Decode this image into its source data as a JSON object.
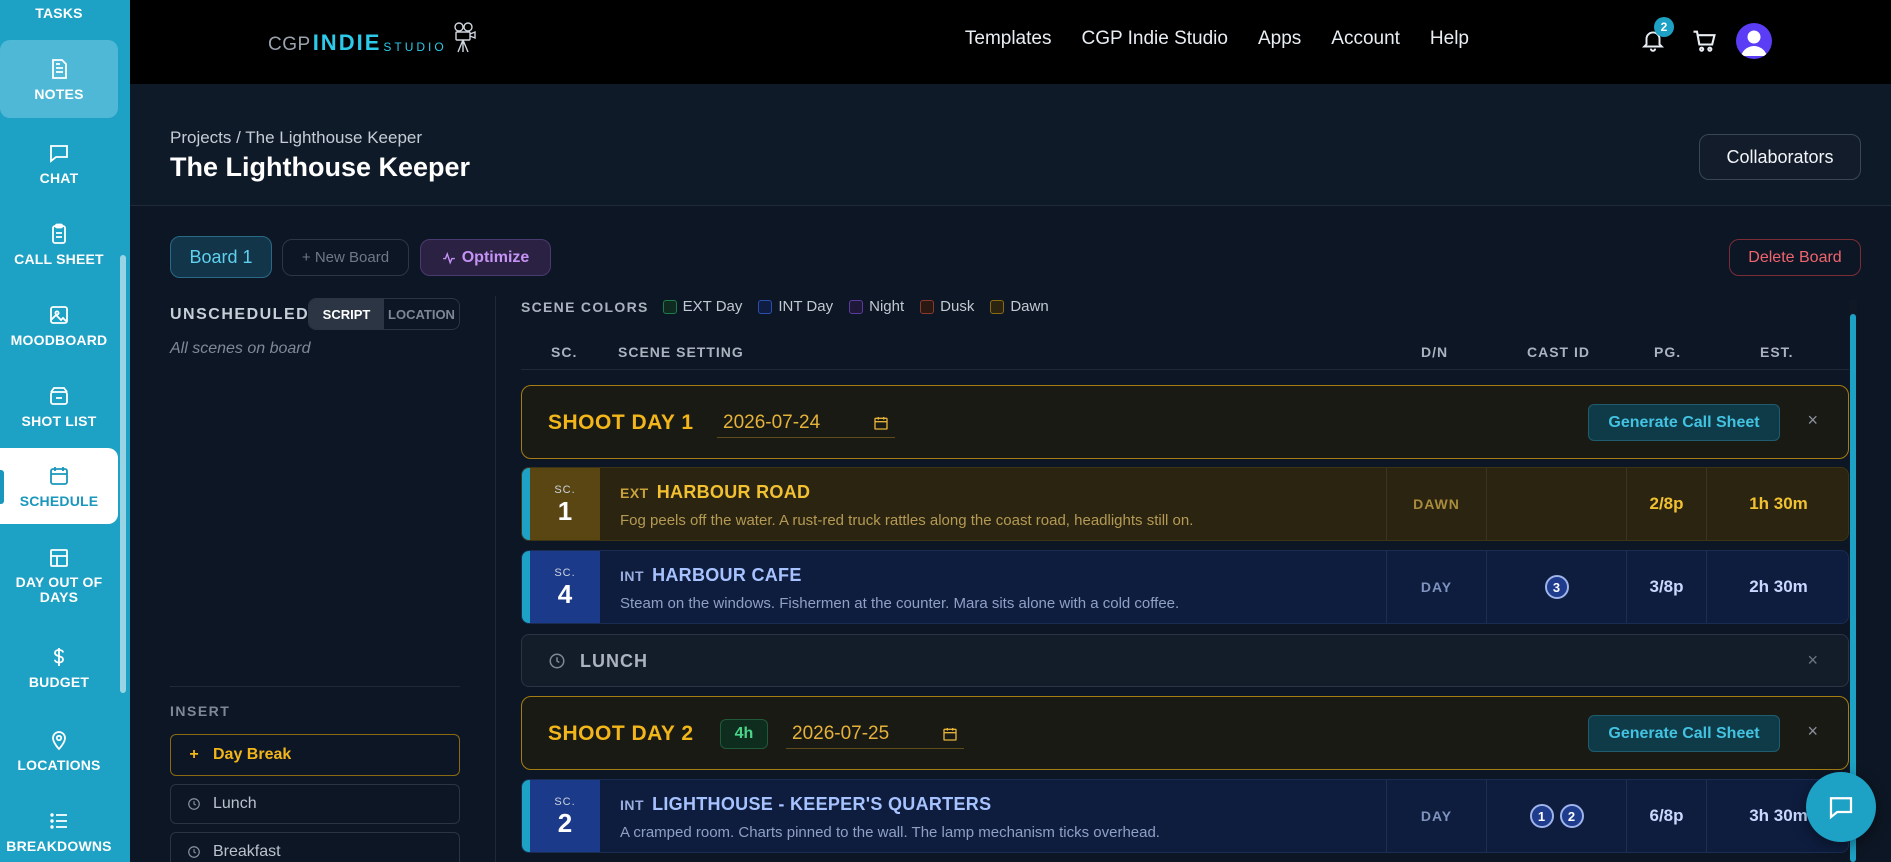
{
  "sidebar": {
    "items": [
      {
        "id": "tasks",
        "label": "TASKS",
        "icon": "tasks-icon"
      },
      {
        "id": "notes",
        "label": "NOTES",
        "icon": "notes-icon"
      },
      {
        "id": "chat",
        "label": "CHAT",
        "icon": "chat-icon"
      },
      {
        "id": "call-sheet",
        "label": "CALL SHEET",
        "icon": "clipboard-icon"
      },
      {
        "id": "moodboard",
        "label": "MOODBOARD",
        "icon": "image-icon"
      },
      {
        "id": "shot-list",
        "label": "SHOT LIST",
        "icon": "clapper-icon"
      },
      {
        "id": "schedule",
        "label": "SCHEDULE",
        "icon": "calendar-icon",
        "active": true
      },
      {
        "id": "dood",
        "label": "DAY OUT OF DAYS",
        "icon": "grid-icon"
      },
      {
        "id": "budget",
        "label": "BUDGET",
        "icon": "dollar-icon"
      },
      {
        "id": "locations",
        "label": "LOCATIONS",
        "icon": "map-pin-icon"
      },
      {
        "id": "breakdowns",
        "label": "BREAKDOWNS",
        "icon": "list-icon"
      }
    ],
    "accent": "#1da1c4"
  },
  "topbar": {
    "logo": {
      "part1": "CGP",
      "part2": "INDIE",
      "part3": "STUDIO"
    },
    "nav": [
      "Templates",
      "CGP Indie Studio",
      "Apps",
      "Account",
      "Help"
    ],
    "notifications_count": "2"
  },
  "header": {
    "breadcrumb": "Projects / The Lighthouse Keeper",
    "title": "The Lighthouse Keeper",
    "collaborators_label": "Collaborators"
  },
  "boards": {
    "current": "Board 1",
    "new_board_label": "+ New Board",
    "optimize_label": "Optimize",
    "delete_label": "Delete Board"
  },
  "unscheduled": {
    "title": "UNSCHEDULED",
    "toggle": [
      "SCRIPT",
      "LOCATION"
    ],
    "toggle_selected": "SCRIPT",
    "empty_text": "All scenes on board",
    "insert_label": "INSERT",
    "insert_items": [
      {
        "icon": "+",
        "label": "Day Break"
      },
      {
        "icon": "clock",
        "label": "Lunch"
      },
      {
        "icon": "clock",
        "label": "Breakfast"
      }
    ]
  },
  "legend": {
    "title": "SCENE COLORS",
    "items": [
      {
        "label": "EXT Day",
        "color": "#1f7a4a"
      },
      {
        "label": "INT Day",
        "color": "#2a4fb0"
      },
      {
        "label": "Night",
        "color": "#5a3ba0"
      },
      {
        "label": "Dusk",
        "color": "#8a3a2a"
      },
      {
        "label": "Dawn",
        "color": "#8a6a10"
      }
    ]
  },
  "columns": {
    "sc": "SC.",
    "setting": "SCENE SETTING",
    "dn": "D/N",
    "cast": "CAST ID",
    "pg": "PG.",
    "est": "EST."
  },
  "schedule": {
    "day1": {
      "title": "SHOOT DAY 1",
      "date": "2026-07-24",
      "generate_label": "Generate Call Sheet"
    },
    "scene1": {
      "sc_label": "SC.",
      "number": "1",
      "ie": "EXT",
      "setting": "HARBOUR ROAD",
      "description": "Fog peels off the water. A rust-red truck rattles along the coast road, headlights still on.",
      "dn": "DAWN",
      "cast": [],
      "pages": "2/8p",
      "est": "1h 30m"
    },
    "scene4": {
      "sc_label": "SC.",
      "number": "4",
      "ie": "INT",
      "setting": "HARBOUR CAFE",
      "description": "Steam on the windows. Fishermen at the counter. Mara sits alone with a cold coffee.",
      "dn": "DAY",
      "cast": [
        "3"
      ],
      "pages": "3/8p",
      "est": "2h 30m"
    },
    "lunch": {
      "label": "LUNCH"
    },
    "day2": {
      "title": "SHOOT DAY 2",
      "hours": "4h",
      "date": "2026-07-25",
      "generate_label": "Generate Call Sheet"
    },
    "scene2": {
      "sc_label": "SC.",
      "number": "2",
      "ie": "INT",
      "setting": "LIGHTHOUSE - KEEPER'S QUARTERS",
      "description": "A cramped room. Charts pinned to the wall. The lamp mechanism ticks overhead.",
      "dn": "DAY",
      "cast": [
        "1",
        "2"
      ],
      "pages": "6/8p",
      "est": "3h 30m"
    }
  },
  "icons": {
    "close": "×",
    "plus": "+"
  }
}
